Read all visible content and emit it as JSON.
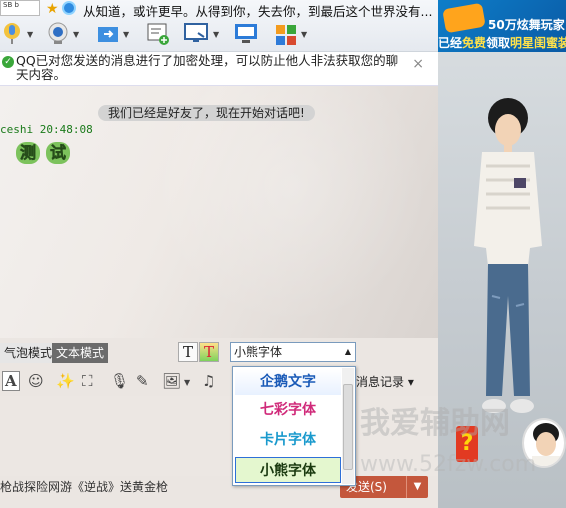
{
  "signature": "从知道，或许更早。从得到你，失去你，到最后这个世界没有...",
  "badge_text": "SB b",
  "toolbar": {
    "items": [
      "voice-call",
      "video-call",
      "file-transfer",
      "remote-assist",
      "screen-share",
      "app-center"
    ]
  },
  "notice": {
    "text": "QQ已对您发送的消息进行了加密处理，可以防止他人非法获取您的聊天内容。",
    "close": "×"
  },
  "chat": {
    "system_msg": "我们已经是好友了，现在开始对话吧!",
    "sender_meta": "ceshi  20:48:08",
    "message_chars": [
      "测",
      "试"
    ]
  },
  "modes": {
    "bubble": "气泡模式",
    "text": "文本模式"
  },
  "font_select": {
    "value": "小熊字体"
  },
  "font_options": [
    "企鹅文字",
    "七彩字体",
    "卡片字体",
    "小熊字体"
  ],
  "history_label": "消息记录",
  "watermark": "我爱辅助网",
  "watermark_url": "www.52fzw.com",
  "ad_text": "枪战探险网游《逆战》送黄金枪",
  "send": {
    "label": "发送(S)"
  },
  "side_banner": {
    "line1": "50万炫舞玩家",
    "line2a": "已经",
    "line2b": "免费",
    "line2c": "领取",
    "line2d": "明星闺蜜装"
  },
  "colors": {
    "accent": "#0e7ec9",
    "send": "#c4573c"
  }
}
